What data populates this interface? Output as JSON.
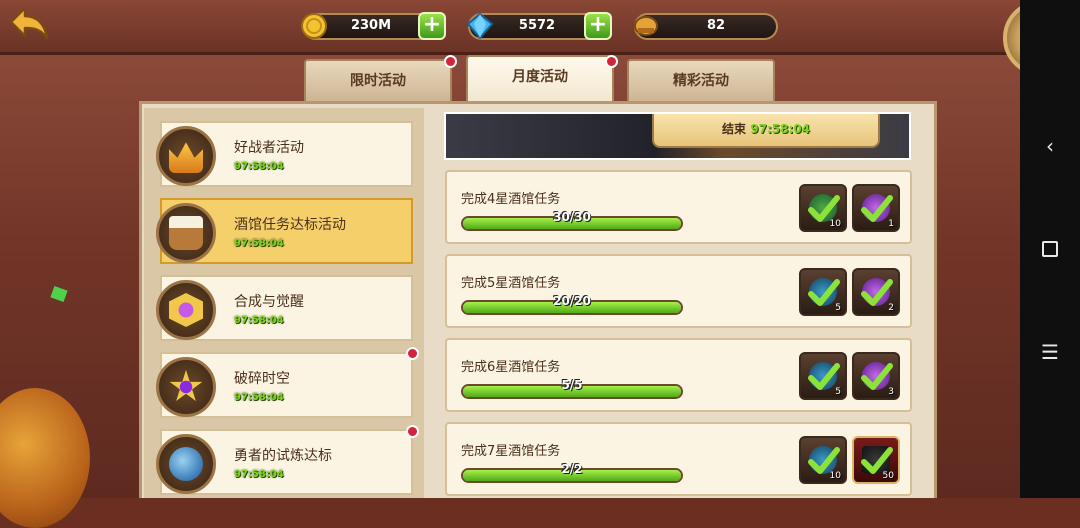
{
  "topbar": {
    "gold": "230M",
    "gems": "5572",
    "keys": "82"
  },
  "tabs": [
    {
      "label": "限时活动"
    },
    {
      "label": "月度活动"
    },
    {
      "label": "精彩活动"
    }
  ],
  "events": [
    {
      "name": "好战者活动",
      "timer": "97:58:04"
    },
    {
      "name": "酒馆任务达标活动",
      "timer": "97:58:04"
    },
    {
      "name": "合成与觉醒",
      "timer": "97:58:04"
    },
    {
      "name": "破碎时空",
      "timer": "97:58:04"
    },
    {
      "name": "勇者的试炼达标",
      "timer": "97:58:04"
    }
  ],
  "banner": {
    "end_label": "结束",
    "end_time": "97:58:04"
  },
  "tasks": [
    {
      "name": "完成4星酒馆任务",
      "progress": "30/30",
      "fill": 1.0,
      "rewards": [
        {
          "count": "10"
        },
        {
          "count": "1"
        }
      ]
    },
    {
      "name": "完成5星酒馆任务",
      "progress": "20/20",
      "fill": 1.0,
      "rewards": [
        {
          "count": "5"
        },
        {
          "count": "2"
        }
      ]
    },
    {
      "name": "完成6星酒馆任务",
      "progress": "5/5",
      "fill": 1.0,
      "rewards": [
        {
          "count": "5"
        },
        {
          "count": "3"
        }
      ]
    },
    {
      "name": "完成7星酒馆任务",
      "progress": "2/2",
      "fill": 1.0,
      "rewards": [
        {
          "count": "10"
        },
        {
          "count": "50"
        }
      ]
    }
  ],
  "colors": {
    "accent_green": "#7ed321",
    "badge_red": "#d2243a",
    "selected_gold": "#f5cf69"
  }
}
